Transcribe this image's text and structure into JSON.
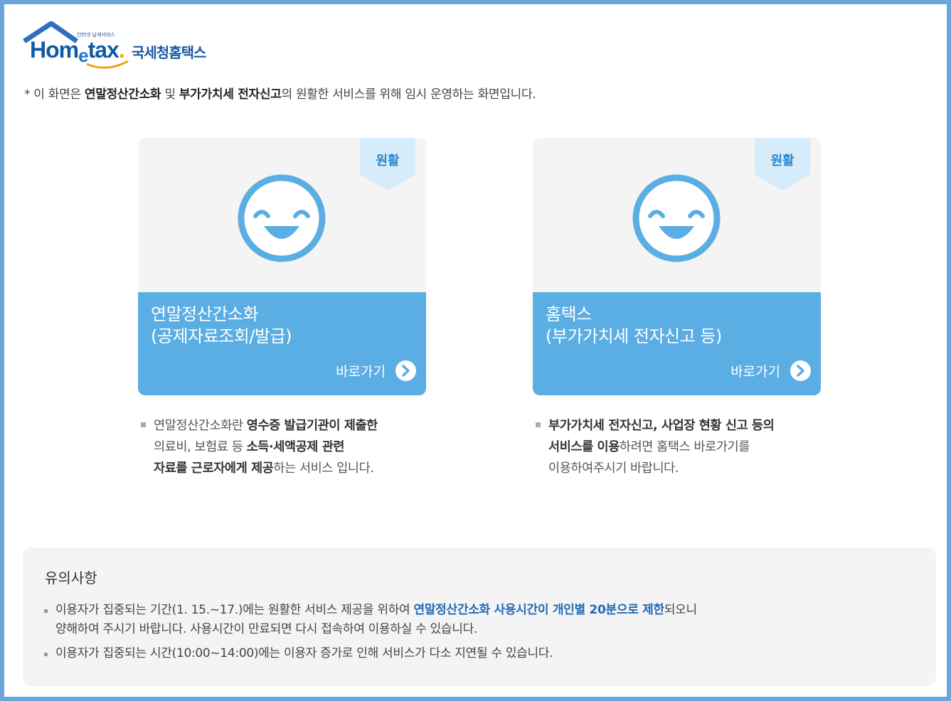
{
  "logo": {
    "small_text": "인터넷 납세서비스",
    "brand_part1": "Hom",
    "brand_e": "e",
    "brand_part2": "tax",
    "brand_dot": ".",
    "korean": "국세청홈택스",
    "colors": {
      "roof": "#2d6fc0",
      "swoosh": "#f2a21b"
    }
  },
  "notice": {
    "prefix": "* 이 화면은 ",
    "bold1": "연말정산간소화",
    "mid": " 및 ",
    "bold2": "부가가치세 전자신고",
    "suffix": "의 원활한 서비스를 위해 임시 운영하는 화면입니다."
  },
  "cards": [
    {
      "status": "원활",
      "status_icon": "smiley-face-icon",
      "title_line1": "연말정산간소화",
      "title_line2": "(공제자료조회/발급)",
      "go_label": "바로가기",
      "desc": {
        "p1": "연말정산간소화란 ",
        "b1": "영수증 발급기관이 제출한",
        "p2": "의료비, 보험료 등 ",
        "b2": "소득·세액공제 관련",
        "b3": "자료를 근로자에게 제공",
        "p3": "하는 서비스 입니다."
      }
    },
    {
      "status": "원활",
      "status_icon": "smiley-face-icon",
      "title_line1": "홈택스",
      "title_line2": "(부가가치세 전자신고 등)",
      "go_label": "바로가기",
      "desc": {
        "b1": "부가가치세 전자신고, 사업장 현황 신고 등의",
        "b2": "서비스를 이용",
        "p1": "하려면 홈택스 바로가기를",
        "p2": "이용하여주시기 바랍니다."
      }
    }
  ],
  "caution": {
    "heading": "유의사항",
    "item1_a": "이용자가 집중되는 기간(1. 15.~17.)에는 원활한 서비스 제공을 위하여 ",
    "item1_hl": "연말정산간소화 사용시간이 개인별 20분으로 제한",
    "item1_b": "되오니",
    "item1_line2": "양해하여 주시기 바랍니다. 사용시간이 만료되면 다시 접속하여 이용하실 수 있습니다.",
    "item2": "이용자가 집중되는 시간(10:00~14:00)에는 이용자 증가로 인해 서비스가 다소 지연될 수 있습니다."
  },
  "colors": {
    "frame": "#6aa6dc",
    "card_blue": "#5aaee3",
    "smiley": "#5aaee3",
    "ribbon": "#d7ecfa",
    "highlight": "#1f6bb5"
  }
}
